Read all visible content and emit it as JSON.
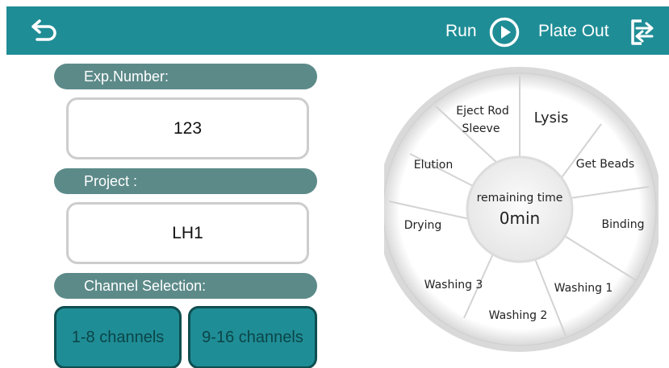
{
  "header": {
    "run_label": "Run",
    "plate_out_label": "Plate Out",
    "icons": [
      "back-arrow-icon",
      "play-circle-icon",
      "export-icon"
    ],
    "color": "#1f8d96"
  },
  "form": {
    "exp_number_label": "Exp.Number:",
    "exp_number_value": "123",
    "project_label": "Project :",
    "project_value": "LH1",
    "channel_label": "Channel Selection:",
    "channels": [
      "1-8 channels",
      "9-16 channels"
    ]
  },
  "wheel": {
    "center_label": "remaining time",
    "center_value": "0min",
    "segments": [
      "Lysis",
      "Get Beads",
      "Binding",
      "Washing 1",
      "Washing 2",
      "Washing 3",
      "Drying",
      "Elution"
    ],
    "eject_line1": "Eject Rod",
    "eject_line2": "Sleeve"
  }
}
